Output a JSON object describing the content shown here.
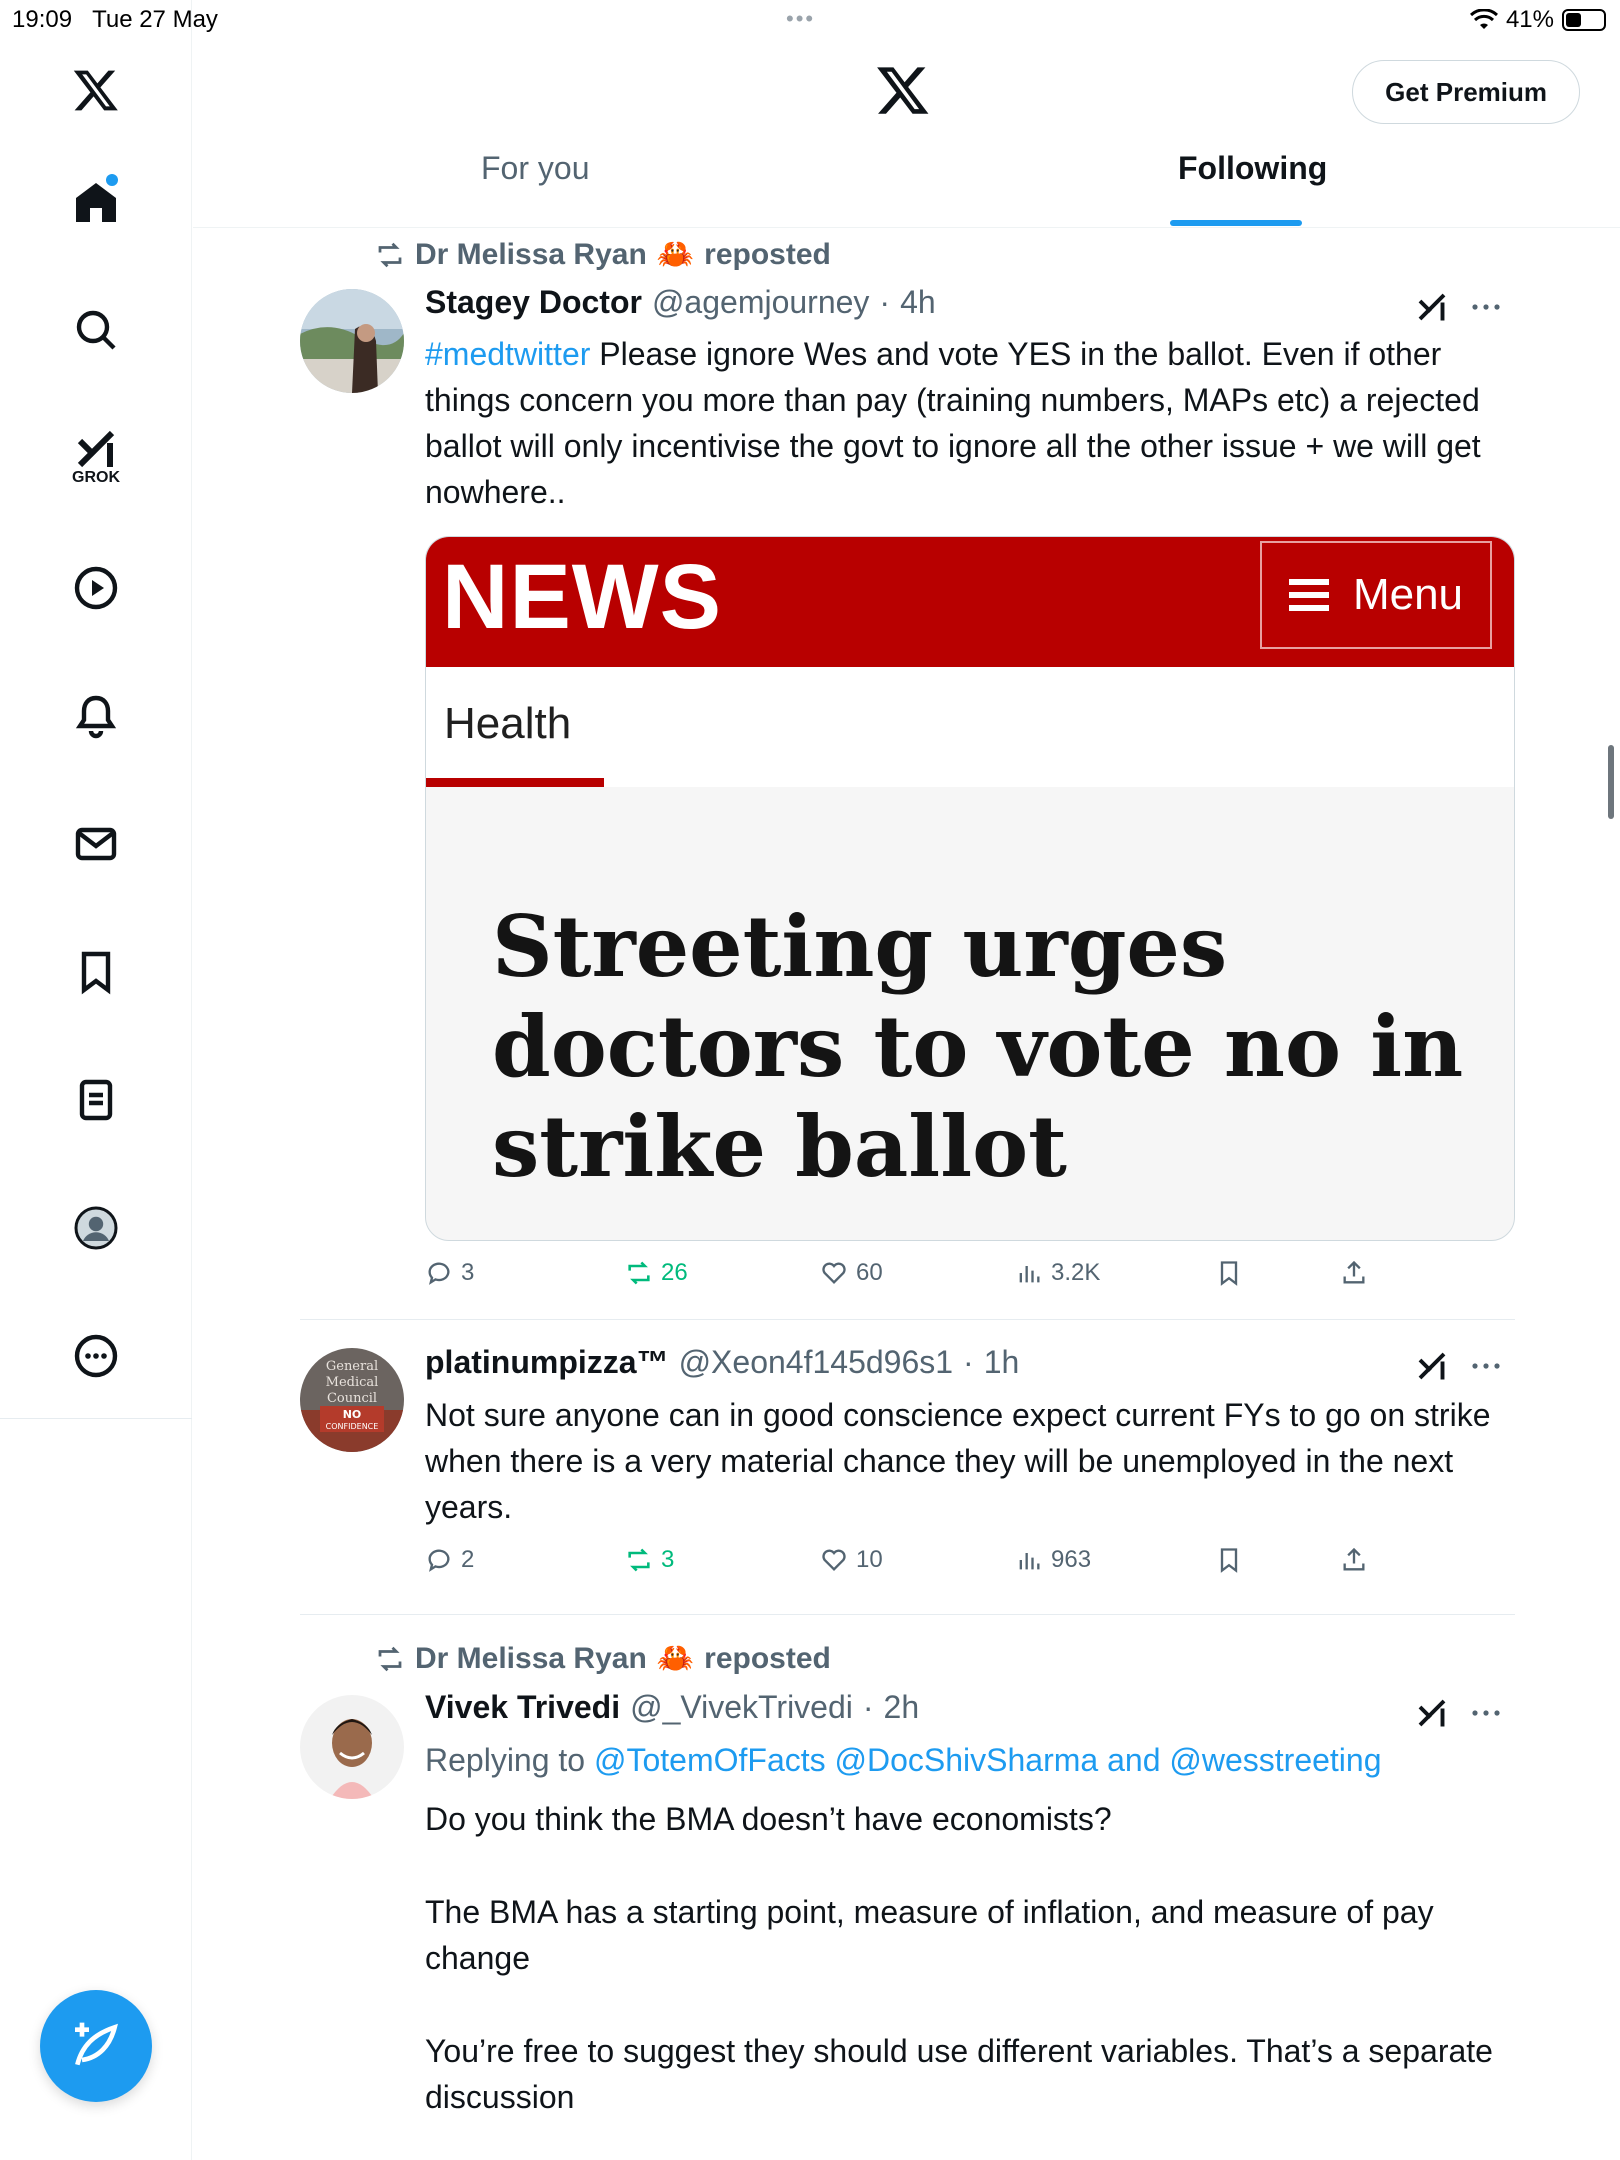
{
  "status_bar": {
    "time": "19:09",
    "date": "Tue 27 May",
    "battery": "41%",
    "battery_level": 0.41
  },
  "header": {
    "premium_label": "Get Premium",
    "tabs": [
      {
        "label": "For you",
        "active": false
      },
      {
        "label": "Following",
        "active": true
      }
    ]
  },
  "sidebar": {
    "items": [
      {
        "icon": "x-logo-icon"
      },
      {
        "icon": "home-icon",
        "active": true
      },
      {
        "icon": "search-icon"
      },
      {
        "icon": "grok-icon",
        "label": "GROK"
      },
      {
        "icon": "video-icon"
      },
      {
        "icon": "notifications-icon"
      },
      {
        "icon": "messages-icon"
      },
      {
        "icon": "bookmarks-icon"
      },
      {
        "icon": "lists-icon"
      },
      {
        "icon": "profile-icon"
      },
      {
        "icon": "more-icon"
      }
    ],
    "compose_icon": "compose-icon"
  },
  "tweets": [
    {
      "repost_by": "Dr Melissa Ryan",
      "repost_emoji": "🦀",
      "repost_suffix": "reposted",
      "name": "Stagey Doctor",
      "handle": "@agemjourney",
      "time": "4h",
      "hashtag": "#medtwitter",
      "text": " Please ignore Wes and vote YES in the ballot. Even if other things concern you more than pay (training numbers, MAPs etc) a rejected ballot will only incentivise the govt to ignore all the other issue + we will get nowhere..",
      "card": {
        "logo": "NEWS",
        "menu": "Menu",
        "section": "Health",
        "headline": "Streeting urges doctors to vote no in strike ballot"
      },
      "stats": {
        "replies": "3",
        "reposts": "26",
        "likes": "60",
        "views": "3.2K"
      }
    },
    {
      "name": "platinumpizza™",
      "handle": "@Xeon4f145d96s1",
      "time": "1h",
      "text": "Not sure anyone can in good conscience expect current FYs to go on strike when there is a very material chance they will be unemployed in the next years.",
      "avatar_text": [
        "General",
        "Medical",
        "Council",
        "NO",
        "CONFIDENCE"
      ],
      "stats": {
        "replies": "2",
        "reposts": "3",
        "likes": "10",
        "views": "963"
      }
    },
    {
      "repost_by": "Dr Melissa Ryan",
      "repost_emoji": "🦀",
      "repost_suffix": "reposted",
      "name": "Vivek Trivedi",
      "handle": "@_VivekTrivedi",
      "time": "2h",
      "reply_prefix": "Replying to ",
      "reply_mentions": "@TotemOfFacts @DocShivSharma and @wesstreeting",
      "paragraphs": [
        "Do you think the BMA doesn’t have economists?",
        "The BMA has a starting point, measure of inflation, and measure of pay change",
        "You’re free to suggest they should use different variables. That’s a separate discussion"
      ]
    }
  ],
  "colors": {
    "accent": "#1d9bf0",
    "repost_green": "#00ba7c",
    "news_red": "#b80000",
    "secondary_text": "#536471"
  }
}
